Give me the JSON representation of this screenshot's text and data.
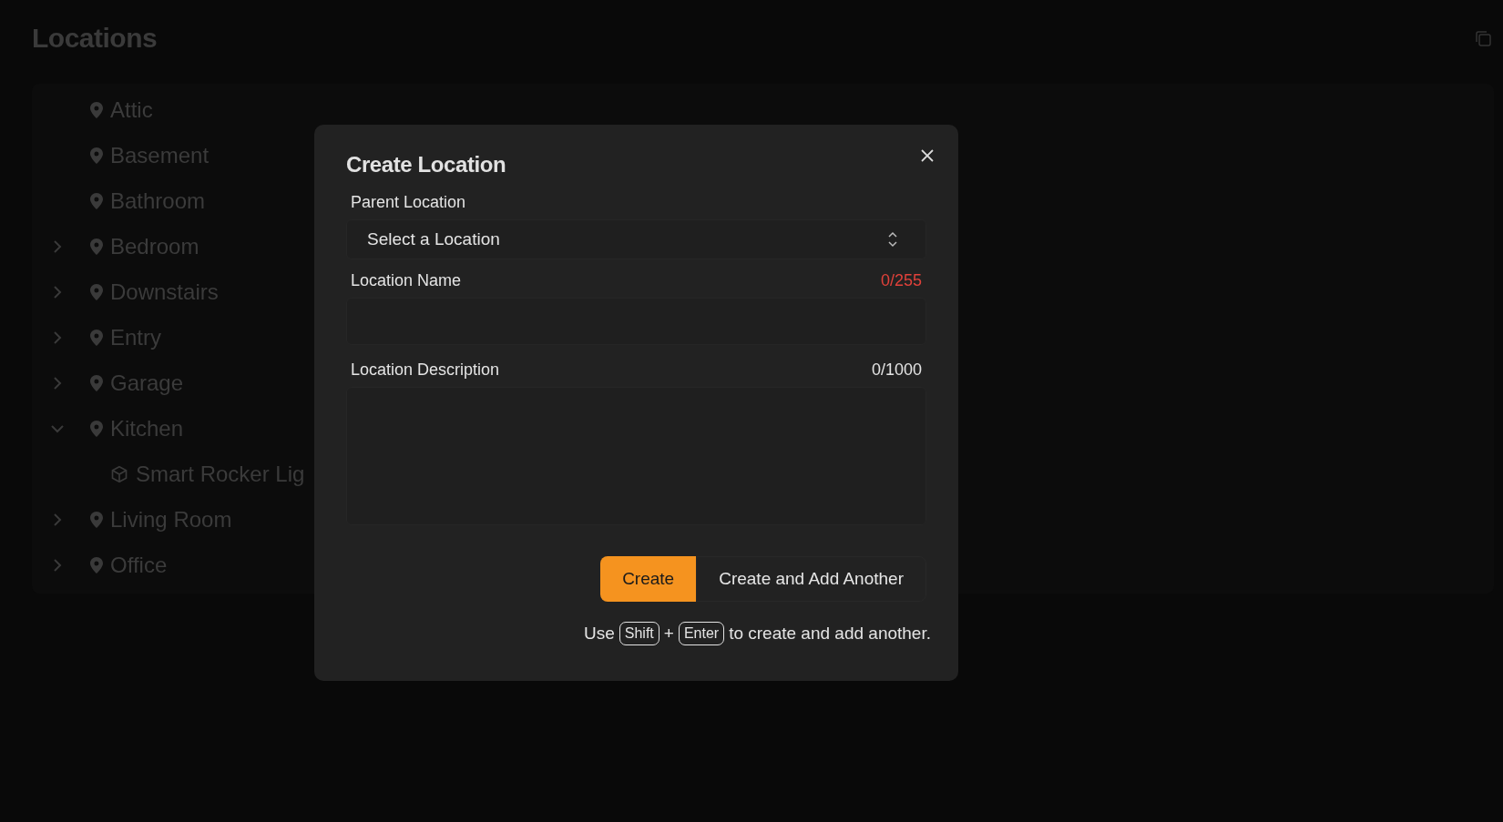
{
  "page": {
    "title": "Locations"
  },
  "tree": [
    {
      "label": "Attic",
      "kind": "location",
      "expandable": false
    },
    {
      "label": "Basement",
      "kind": "location",
      "expandable": false
    },
    {
      "label": "Bathroom",
      "kind": "location",
      "expandable": false
    },
    {
      "label": "Bedroom",
      "kind": "location",
      "expandable": true,
      "expanded": false
    },
    {
      "label": "Downstairs",
      "kind": "location",
      "expandable": true,
      "expanded": false
    },
    {
      "label": "Entry",
      "kind": "location",
      "expandable": true,
      "expanded": false
    },
    {
      "label": "Garage",
      "kind": "location",
      "expandable": true,
      "expanded": false
    },
    {
      "label": "Kitchen",
      "kind": "location",
      "expandable": true,
      "expanded": true,
      "children": [
        {
          "label": "Smart Rocker Lig",
          "kind": "item",
          "expandable": false
        }
      ]
    },
    {
      "label": "Living Room",
      "kind": "location",
      "expandable": true,
      "expanded": false
    },
    {
      "label": "Office",
      "kind": "location",
      "expandable": true,
      "expanded": false
    }
  ],
  "dialog": {
    "title": "Create Location",
    "parent": {
      "label": "Parent Location",
      "value": "Select a Location"
    },
    "name": {
      "label": "Location Name",
      "count": "0/255",
      "over_limit": true
    },
    "description": {
      "label": "Location Description",
      "count": "0/1000",
      "over_limit": false
    },
    "buttons": [
      {
        "label": "Create",
        "kind": "primary"
      },
      {
        "label": "Create and Add Another",
        "kind": "secondary"
      }
    ],
    "hint": {
      "before": "Use",
      "keys": [
        "Shift",
        "Enter"
      ],
      "joiner": "+",
      "after": "to create and add another."
    }
  }
}
